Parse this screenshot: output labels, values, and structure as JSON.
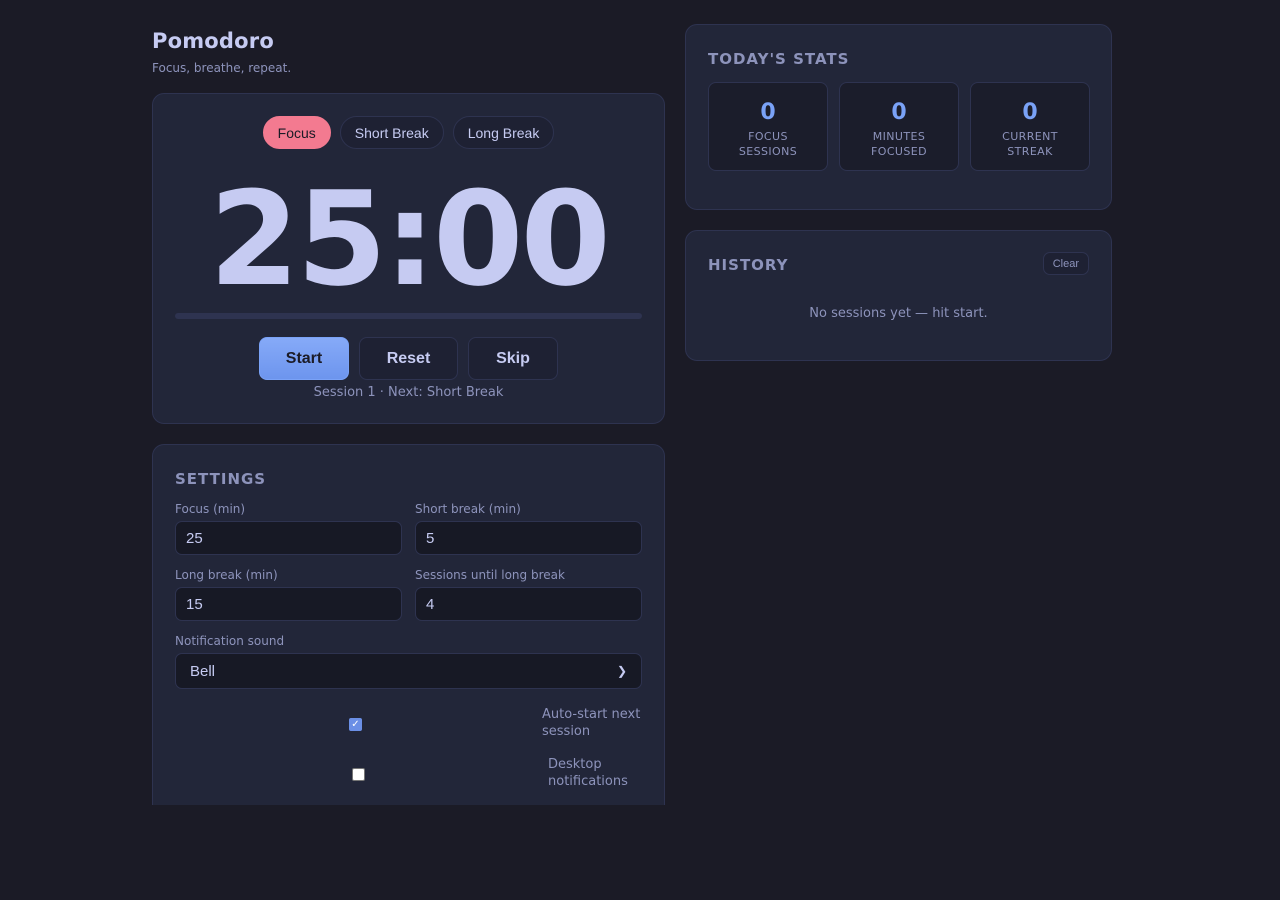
{
  "app": {
    "title": "Pomodoro",
    "subtitle": "Focus, breathe, repeat."
  },
  "timer": {
    "tabs": [
      {
        "label": "Focus",
        "active": true
      },
      {
        "label": "Short Break",
        "active": false
      },
      {
        "label": "Long Break",
        "active": false
      }
    ],
    "time": "25:00",
    "progress": 0,
    "controls": {
      "start_label": "Start",
      "reset_label": "Reset",
      "skip_label": "Skip"
    },
    "session_info": "Session 1 · Next: Short Break"
  },
  "settings": {
    "title": "SETTINGS",
    "fields": {
      "focus": {
        "label": "Focus (min)",
        "value": "25"
      },
      "short_break": {
        "label": "Short break (min)",
        "value": "5"
      },
      "long_break": {
        "label": "Long break (min)",
        "value": "15"
      },
      "sessions_until_long": {
        "label": "Sessions until long break",
        "value": "4"
      }
    },
    "sound": {
      "label": "Notification sound",
      "value": "Bell"
    },
    "auto_start": {
      "label": "Auto-start next session",
      "checked": true
    },
    "desktop_notifications": {
      "label": "Desktop notifications",
      "checked": false
    }
  },
  "stats": {
    "title": "TODAY'S STATS",
    "tiles": [
      {
        "value": "0",
        "label": "FOCUS SESSIONS"
      },
      {
        "value": "0",
        "label": "MINUTES FOCUSED"
      },
      {
        "value": "0",
        "label": "CURRENT STREAK"
      }
    ]
  },
  "history": {
    "title": "HISTORY",
    "clear_label": "Clear",
    "empty_message": "No sessions yet — hit start."
  },
  "colors": {
    "background": "#1b1b26",
    "card": "#222639",
    "accent": "#7aa2f7",
    "focus_tab": "#f37a90",
    "text": "#c6cbf2",
    "muted": "#8d93bb"
  }
}
